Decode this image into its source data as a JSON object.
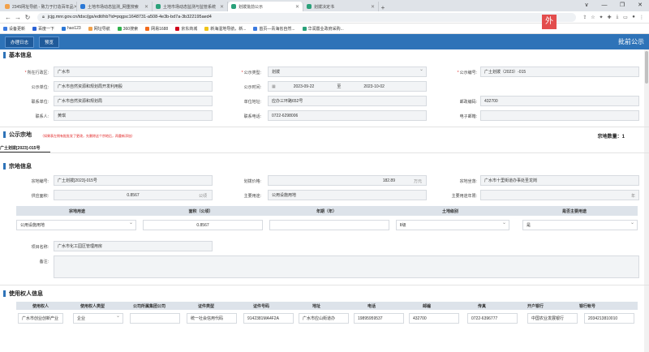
{
  "browser": {
    "tabs": [
      {
        "label": "2345网址导航 - 致力于打造百年品",
        "color": "#f2a14a"
      },
      {
        "label": "土地市场动态监测_网重搜索",
        "color": "#2b78d6"
      },
      {
        "label": "土地市场动态监测与监管系统",
        "color": "#2aa17a"
      },
      {
        "label": "划拨批前公示",
        "color": "#2aa17a"
      },
      {
        "label": "划拨决定书",
        "color": "#2aa17a"
      }
    ],
    "new_tab": "+",
    "window_controls": [
      "∨",
      "—",
      "❐",
      "✕"
    ],
    "url": "jcjg.mnr.gov.cn/tdsc/jgs/edit/hb?id=pqgsc1648731-a508-4e3b-bd7a-3b322195aed4",
    "ext_badge": "外",
    "bookmarks": [
      {
        "label": "设备更新",
        "color": "#3b7ae0"
      },
      {
        "label": "百度一下",
        "color": "#2b62d6"
      },
      {
        "label": "hao123",
        "color": "#2b78d6"
      },
      {
        "label": "网址导航",
        "color": "#f2a14a"
      },
      {
        "label": "360搜索",
        "color": "#2fb24c"
      },
      {
        "label": "网易1688",
        "color": "#f26a1b"
      },
      {
        "label": "京东商城",
        "color": "#d0021b"
      },
      {
        "label": "新海湿地导航，新...",
        "color": "#f0c419"
      },
      {
        "label": "首页—青海省自然...",
        "color": "#3b7ae0"
      },
      {
        "label": "华润置业政府采购...",
        "color": "#2aa17a"
      }
    ]
  },
  "appbar": {
    "btn_log": "办理日志",
    "btn_preview": "预览",
    "title": "批前公示"
  },
  "basic": {
    "section": "基本信息",
    "region_label": "所在行政区:",
    "region_value": "广水市",
    "type_label": "公示类型:",
    "type_value": "划拨",
    "code_label": "公示编号:",
    "code_value": "广土划拨（2023）-015",
    "unit_label": "公示单位:",
    "unit_value": "广水市自然资源和规划局开发利用股",
    "period_label": "公示时间:",
    "period_start": "2023-09-22",
    "period_sep": "至",
    "period_end": "2023-10-02",
    "contact_unit_label": "联系单位:",
    "contact_unit_value": "广水市自然资源和规划局",
    "address_label": "单位地址:",
    "address_value": "应办三环路652号",
    "postcode_label": "邮政编码:",
    "postcode_value": "432700",
    "person_label": "联系人:",
    "person_value": "黄琪",
    "phone_label": "联系电话:",
    "phone_value": "0722-6298006",
    "email_label": "电子邮箱:",
    "email_value": ""
  },
  "parcel_group": {
    "section": "公示宗地",
    "note": "（如果表左侧有批批发了更改，先删除这个宗地后，再重新添加）",
    "count_label": "宗地数量：",
    "count_value": "1",
    "tab": "广土划拨[2023]-015号"
  },
  "parcel": {
    "section": "宗地信息",
    "no_label": "宗地编号:",
    "no_value": "广土划拨[2023]-015号",
    "price_label": "划拨价格:",
    "price_value": "182.89",
    "price_unit": "万元",
    "loc_label": "宗地坐落:",
    "loc_value": "广水市十里街道办事处圣龙岗",
    "area_label": "供应面积:",
    "area_value": "0.8567",
    "area_unit": "公顷",
    "use_label": "主要用途:",
    "use_value": "公用设施用地",
    "term_label": "主要用途年限:",
    "term_unit": "年",
    "table_headers": [
      "宗地用途",
      "面积（公顷）",
      "年期（年）",
      "土地级别",
      "是否主要用途"
    ],
    "row": {
      "use": "公用设施用地",
      "area": "0.8567",
      "years": "",
      "grade": "Ⅱ级",
      "main": "是"
    },
    "project_label": "项目名称:",
    "project_value": "广水市化工园区管理用房",
    "remark_label": "备注:",
    "remark_value": ""
  },
  "user": {
    "section": "使用权人信息",
    "headers": [
      "使用权人",
      "使用权人类型",
      "公司所属集团公司",
      "证件类型",
      "证件号码",
      "地址",
      "电话",
      "邮编",
      "传真",
      "开户银行",
      "银行帐号"
    ],
    "row": [
      "广水市创业创新产业",
      "企业",
      "",
      "统一社会信用代码",
      "9142381MA4F2A",
      "广水市应山街道办",
      "19895959537",
      "432700",
      "0722-6396777",
      "中国农业发展银行",
      "2034213810010"
    ]
  }
}
